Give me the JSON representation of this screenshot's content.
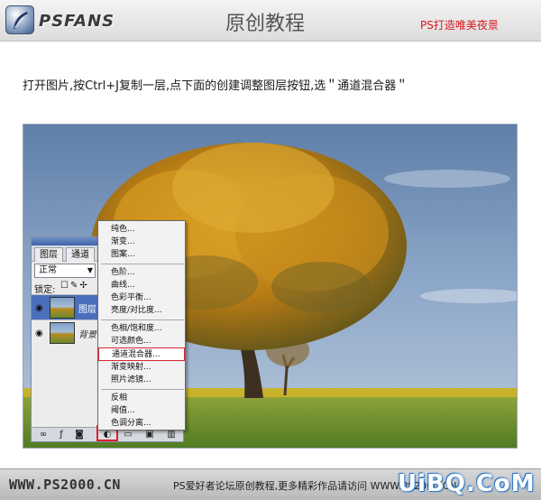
{
  "header": {
    "brand": "PSFANS",
    "title": "原创教程",
    "right_text": "PS打造唯美夜景"
  },
  "instruction": "打开图片,按Ctrl+J复制一层,点下面的创建调整图层按钮,选＂通道混合器＂",
  "layers_panel": {
    "tabs": [
      "图层",
      "通道"
    ],
    "blend_mode": "正常",
    "lock_label": "锁定:",
    "layers": [
      {
        "name": "图层",
        "selected": true
      },
      {
        "name": "背景",
        "selected": false
      }
    ]
  },
  "adjust_menu": {
    "items": [
      "纯色...",
      "渐变...",
      "图案...",
      "色阶...",
      "曲线...",
      "色彩平衡...",
      "亮度/对比度...",
      "色相/饱和度...",
      "可选颜色...",
      "通道混合器...",
      "渐变映射...",
      "照片滤镜...",
      "反相",
      "阈值...",
      "色调分离..."
    ],
    "active": "通道混合器..."
  },
  "footer": {
    "url": "WWW.PS2000.CN",
    "text": "PS爱好者论坛原创教程,更多精彩作品请访问 WWW.PS2000.CN"
  },
  "watermark": "UiBQ.CoM",
  "colors": {
    "accent_red": "#d9181f",
    "selection_blue": "#4a6fbc"
  }
}
